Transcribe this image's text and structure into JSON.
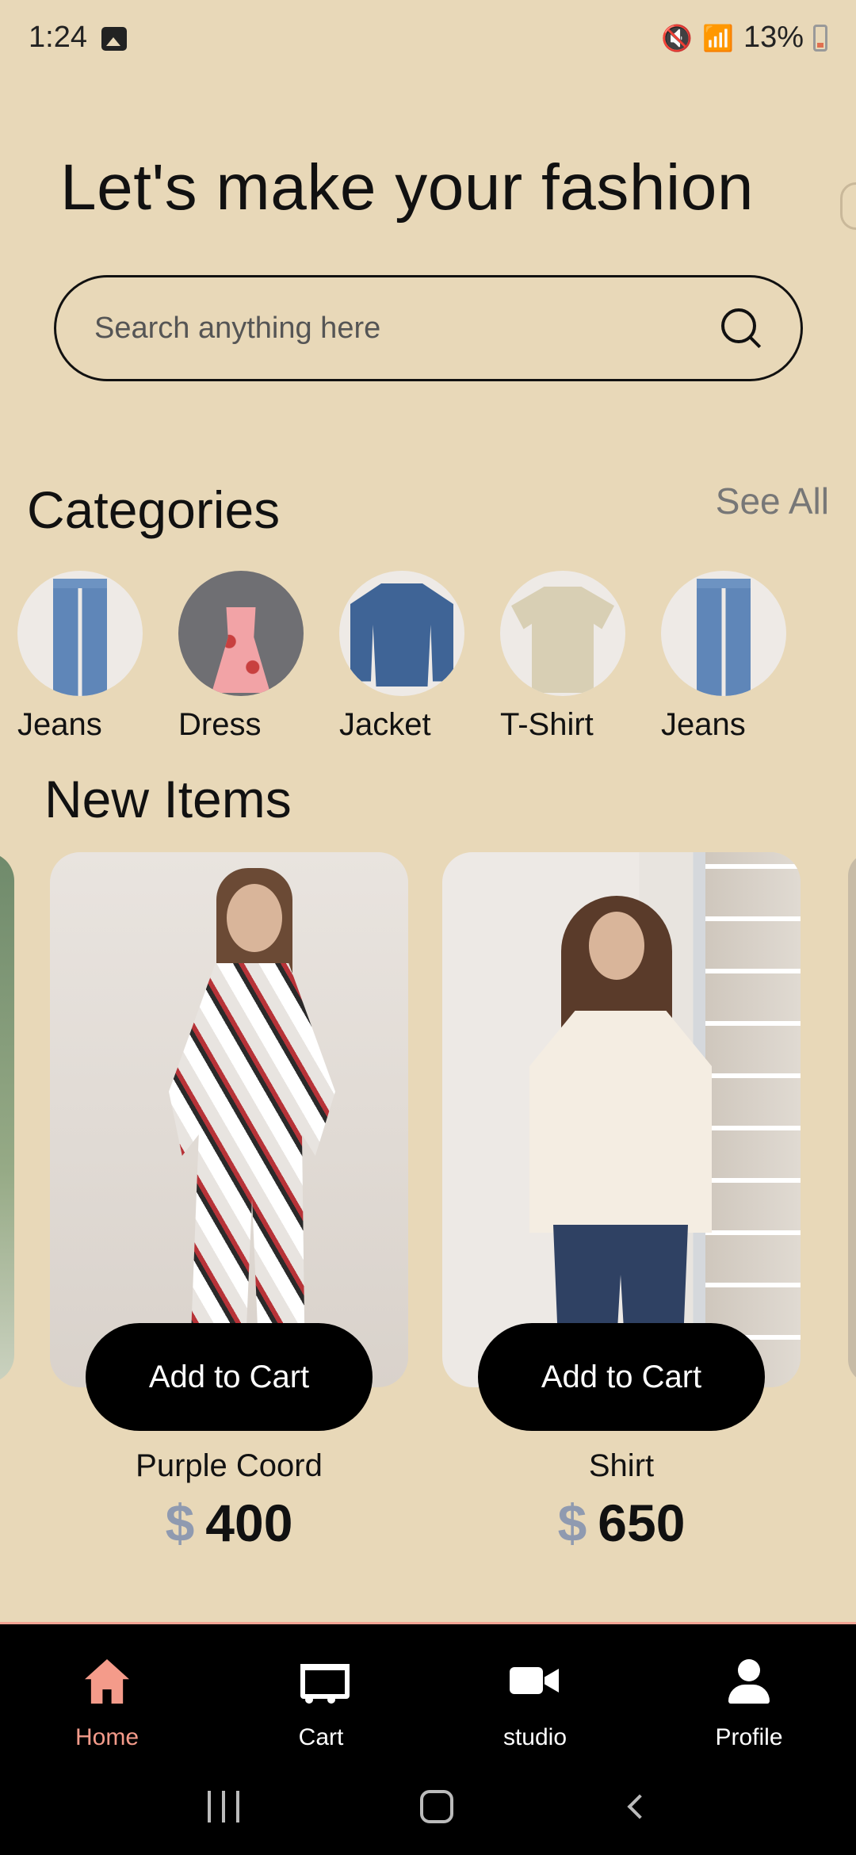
{
  "status_bar": {
    "time": "1:24",
    "battery": "13%",
    "icons": [
      "gallery-icon",
      "mute-icon",
      "wifi-icon",
      "wifi-calling-icon",
      "signal-icon",
      "battery-icon"
    ]
  },
  "hero": {
    "title": "Let's make your fashion"
  },
  "search": {
    "placeholder": "Search anything here"
  },
  "categories": {
    "title": "Categories",
    "see_all": "See All",
    "items": [
      {
        "label": "Jeans",
        "icon": "jeans-image"
      },
      {
        "label": "Dress",
        "icon": "dress-image"
      },
      {
        "label": "Jacket",
        "icon": "jacket-image"
      },
      {
        "label": "T-Shirt",
        "icon": "tshirt-image"
      },
      {
        "label": "Jeans",
        "icon": "jeans-image"
      }
    ]
  },
  "new_items": {
    "title": "New Items",
    "products": [
      {
        "name": "Purple Coord",
        "currency": "$",
        "price": "400",
        "button": "Add to Cart"
      },
      {
        "name": "Shirt",
        "currency": "$",
        "price": "650",
        "button": "Add to Cart"
      }
    ]
  },
  "bottom_nav": {
    "items": [
      {
        "label": "Home",
        "icon": "home-icon",
        "active": true
      },
      {
        "label": "Cart",
        "icon": "cart-icon",
        "active": false
      },
      {
        "label": "studio",
        "icon": "video-icon",
        "active": false
      },
      {
        "label": "Profile",
        "icon": "profile-icon",
        "active": false
      }
    ]
  },
  "colors": {
    "background": "#e8d8b8",
    "accent": "#f49b8a",
    "button": "#000000",
    "price_currency": "#8f9ab0"
  }
}
